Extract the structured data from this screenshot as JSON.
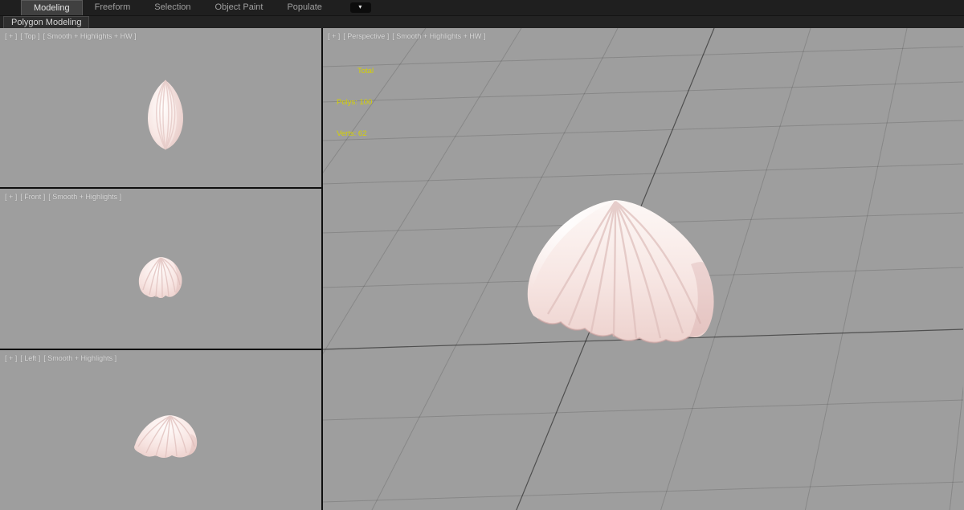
{
  "ribbon": {
    "tabs": [
      {
        "label": "Modeling",
        "active": true
      },
      {
        "label": "Freeform",
        "active": false
      },
      {
        "label": "Selection",
        "active": false
      },
      {
        "label": "Object Paint",
        "active": false
      },
      {
        "label": "Populate",
        "active": false
      }
    ],
    "toggle_icon": "▾",
    "subtab": "Polygon Modeling"
  },
  "viewports": {
    "top": {
      "plus": "[ + ]",
      "name": "[ Top ]",
      "shading": "[ Smooth + Highlights + HW ]"
    },
    "front": {
      "plus": "[ + ]",
      "name": "[ Front ]",
      "shading": "[ Smooth + Highlights ]"
    },
    "left": {
      "plus": "[ + ]",
      "name": "[ Left ]",
      "shading": "[ Smooth + Highlights ]"
    },
    "perspective": {
      "plus": "[ + ]",
      "name": "[ Perspective ]",
      "shading": "[ Smooth + Highlights + HW ]"
    }
  },
  "stats": {
    "total_label": "Total",
    "polys": "Polys: 100",
    "verts": "Verts: 62"
  },
  "colors": {
    "stats_text": "#d6d200",
    "viewport_bg": "#9e9e9e",
    "ribbon_bg": "#1f1f1f"
  }
}
